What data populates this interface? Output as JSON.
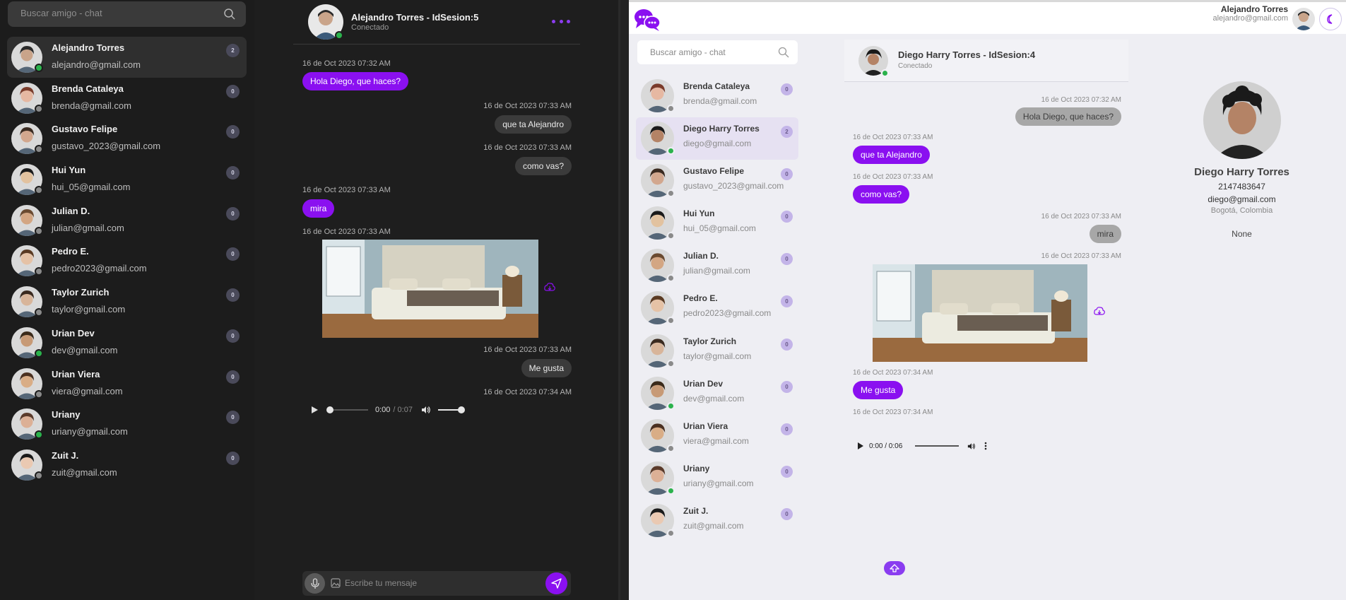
{
  "search_placeholder": "Buscar amigo - chat",
  "dark": {
    "contacts": [
      {
        "name": "Alejandro Torres",
        "email": "alejandro@gmail.com",
        "badge": "2",
        "online": true,
        "active": true,
        "skin": "#c9a48a",
        "hair": "#2a2a2a"
      },
      {
        "name": "Brenda Cataleya",
        "email": "brenda@gmail.com",
        "badge": "0",
        "online": false,
        "skin": "#e6b8a2",
        "hair": "#7a3b2a"
      },
      {
        "name": "Gustavo Felipe",
        "email": "gustavo_2023@gmail.com",
        "badge": "0",
        "online": false,
        "skin": "#d2a78e",
        "hair": "#3a2a20"
      },
      {
        "name": "Hui Yun",
        "email": "hui_05@gmail.com",
        "badge": "0",
        "online": false,
        "skin": "#e2c29f",
        "hair": "#1a1a1a"
      },
      {
        "name": "Julian D.",
        "email": "julian@gmail.com",
        "badge": "0",
        "online": false,
        "skin": "#d3a683",
        "hair": "#6a4a30"
      },
      {
        "name": "Pedro E.",
        "email": "pedro2023@gmail.com",
        "badge": "0",
        "online": false,
        "skin": "#e5c2a6",
        "hair": "#5a3a22"
      },
      {
        "name": "Taylor Zurich",
        "email": "taylor@gmail.com",
        "badge": "0",
        "online": false,
        "skin": "#d8b59a",
        "hair": "#3a2a1f"
      },
      {
        "name": "Urian Dev",
        "email": "dev@gmail.com",
        "badge": "0",
        "online": true,
        "skin": "#c79a76",
        "hair": "#3a2a1a"
      },
      {
        "name": "Urian Viera",
        "email": "viera@gmail.com",
        "badge": "0",
        "online": false,
        "skin": "#d9ad86",
        "hair": "#4a3020"
      },
      {
        "name": "Uriany",
        "email": "uriany@gmail.com",
        "badge": "0",
        "online": true,
        "skin": "#dcb096",
        "hair": "#5a3a2a"
      },
      {
        "name": "Zuit J.",
        "email": "zuit@gmail.com",
        "badge": "0",
        "online": false,
        "skin": "#eac9b2",
        "hair": "#1a1a1a"
      }
    ],
    "chat": {
      "title": "Alejandro Torres - IdSesion:5",
      "status": "Conectado",
      "t1": "16 de Oct 2023 07:32 AM",
      "m1": "Hola Diego, que haces?",
      "t2": "16 de Oct 2023 07:33 AM",
      "m2": "que ta Alejandro",
      "t3": "16 de Oct 2023 07:33 AM",
      "m3": "como vas?",
      "t4": "16 de Oct 2023 07:33 AM",
      "m4": "mira",
      "t5": "16 de Oct 2023 07:33 AM",
      "t6": "16 de Oct 2023 07:33 AM",
      "m6": "Me gusta",
      "t7": "16 de Oct 2023 07:34 AM",
      "audio_time": "0:00",
      "audio_duration": "/ 0:07",
      "composer_placeholder": "Escribe tu mensaje"
    }
  },
  "light": {
    "top_user_name": "Alejandro Torres",
    "top_user_email": "alejandro@gmail.com",
    "contacts": [
      {
        "name": "Brenda Cataleya",
        "email": "brenda@gmail.com",
        "badge": "0",
        "online": false,
        "skin": "#e6b8a2",
        "hair": "#7a3b2a"
      },
      {
        "name": "Diego Harry Torres",
        "email": "diego@gmail.com",
        "badge": "2",
        "online": true,
        "active": true,
        "skin": "#b48366",
        "hair": "#1a1a1a"
      },
      {
        "name": "Gustavo Felipe",
        "email": "gustavo_2023@gmail.com",
        "badge": "0",
        "online": false,
        "skin": "#d2a78e",
        "hair": "#3a2a20"
      },
      {
        "name": "Hui Yun",
        "email": "hui_05@gmail.com",
        "badge": "0",
        "online": false,
        "skin": "#e2c29f",
        "hair": "#1a1a1a"
      },
      {
        "name": "Julian D.",
        "email": "julian@gmail.com",
        "badge": "0",
        "online": false,
        "skin": "#d3a683",
        "hair": "#6a4a30"
      },
      {
        "name": "Pedro E.",
        "email": "pedro2023@gmail.com",
        "badge": "0",
        "online": false,
        "skin": "#e5c2a6",
        "hair": "#5a3a22"
      },
      {
        "name": "Taylor Zurich",
        "email": "taylor@gmail.com",
        "badge": "0",
        "online": false,
        "skin": "#d8b59a",
        "hair": "#3a2a1f"
      },
      {
        "name": "Urian Dev",
        "email": "dev@gmail.com",
        "badge": "0",
        "online": true,
        "skin": "#c79a76",
        "hair": "#3a2a1a"
      },
      {
        "name": "Urian Viera",
        "email": "viera@gmail.com",
        "badge": "0",
        "online": false,
        "skin": "#d9ad86",
        "hair": "#4a3020"
      },
      {
        "name": "Uriany",
        "email": "uriany@gmail.com",
        "badge": "0",
        "online": true,
        "skin": "#dcb096",
        "hair": "#5a3a2a"
      },
      {
        "name": "Zuit J.",
        "email": "zuit@gmail.com",
        "badge": "0",
        "online": false,
        "skin": "#eac9b2",
        "hair": "#1a1a1a"
      }
    ],
    "chat": {
      "title": "Diego Harry Torres - IdSesion:4",
      "status": "Conectado",
      "t1": "16 de Oct 2023 07:32 AM",
      "m1": "Hola Diego, que haces?",
      "t2": "16 de Oct 2023 07:33 AM",
      "m2": "que ta Alejandro",
      "t3": "16 de Oct 2023 07:33 AM",
      "m3": "como vas?",
      "t4": "16 de Oct 2023 07:33 AM",
      "m4": "mira",
      "t5": "16 de Oct 2023 07:33 AM",
      "t6": "16 de Oct 2023 07:34 AM",
      "m6": "Me gusta",
      "t7": "16 de Oct 2023 07:34 AM",
      "audio_time": "0:00 / 0:06"
    },
    "profile": {
      "name": "Diego Harry Torres",
      "number": "2147483647",
      "email": "diego@gmail.com",
      "location": "Bogotá, Colombia",
      "extra": "None"
    }
  },
  "colors": {
    "accent": "#8a10f0",
    "online": "#2bb24c",
    "offline": "#8a8a8a"
  }
}
